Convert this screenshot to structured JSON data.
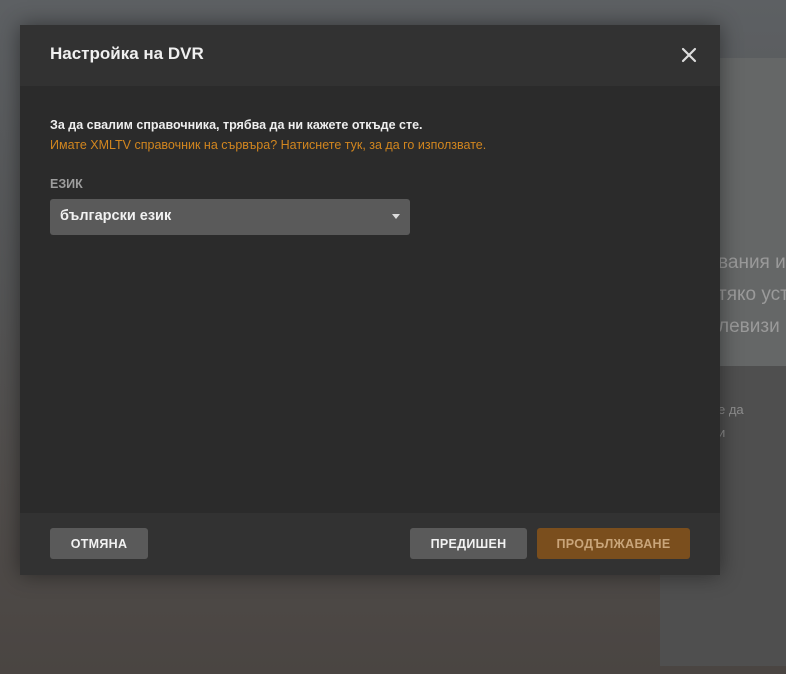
{
  "background": {
    "lines_big": [
      "вания и",
      "тяко уст",
      "левизи"
    ],
    "lines_small": [
      "е да",
      "и"
    ]
  },
  "dialog": {
    "title": "Настройка на DVR",
    "close_icon": "close-icon",
    "intro_text": "За да свалим справочника, трябва да ни кажете откъде сте.",
    "xmltv_link": "Имате XMLTV справочник на сървъра? Натиснете тук, за да го използвате.",
    "language_label": "ЕЗИК",
    "language_value": "български език"
  },
  "footer": {
    "cancel_label": "ОТМЯНА",
    "previous_label": "ПРЕДИШЕН",
    "continue_label": "ПРОДЪЛЖАВАНЕ"
  },
  "colors": {
    "accent": "#d2861f",
    "continue_button": "#7a4e1d",
    "modal_bg": "#2b2b2b",
    "header_bg": "#323232"
  }
}
